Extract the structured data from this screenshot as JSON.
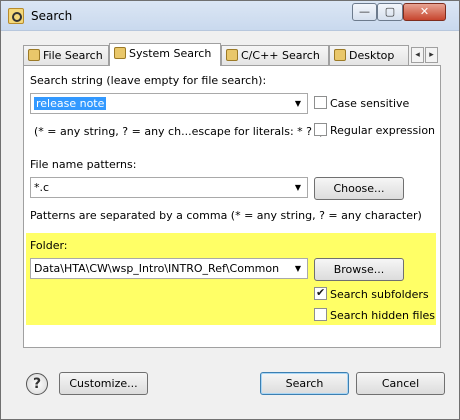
{
  "window": {
    "title": "Search",
    "min_glyph": "—",
    "max_glyph": "▢",
    "close_glyph": "✕"
  },
  "tabs": [
    {
      "label": "File Search"
    },
    {
      "label": "System Search"
    },
    {
      "label": "C/C++ Search"
    },
    {
      "label": "Desktop"
    }
  ],
  "tab_scroll": {
    "left": "◂",
    "right": "▸"
  },
  "search": {
    "label": "Search string (leave empty for file search):",
    "value": "release note",
    "hint": "(* = any string, ? = any ch...escape for literals: * ? \\)",
    "case_sensitive_label": "Case sensitive",
    "case_sensitive_checked": false,
    "regex_label": "Regular expression",
    "regex_checked": false
  },
  "patterns": {
    "label": "File name patterns:",
    "value": "*.c",
    "choose_label": "Choose...",
    "hint": "Patterns are separated by a comma (* = any string, ? = any character)"
  },
  "folder": {
    "label": "Folder:",
    "value": "Data\\HTA\\CW\\wsp_Intro\\INTRO_Ref\\Common",
    "browse_label": "Browse...",
    "subfolders_label": "Search subfolders",
    "subfolders_checked": true,
    "hidden_label": "Search hidden files",
    "hidden_checked": false,
    "highlight_color": "#ffff66"
  },
  "footer": {
    "help_glyph": "?",
    "customize_label": "Customize...",
    "search_label": "Search",
    "cancel_label": "Cancel"
  },
  "dropdown_glyph": "▼"
}
